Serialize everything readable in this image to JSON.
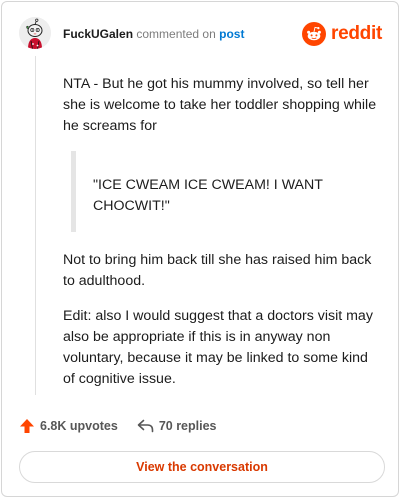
{
  "comment": {
    "username": "FuckUGalen",
    "action_text": "commented on",
    "post_link_label": "post",
    "paragraph_1": "NTA - But he got his mummy involved, so tell her she is welcome to take her toddler shopping while he screams for",
    "quote": "\"ICE CWEAM ICE CWEAM! I WANT CHOCWIT!\"",
    "paragraph_2": "Not to bring him back till she has raised him back to adulthood.",
    "paragraph_3": "Edit: also I would suggest that a doctors visit may also be appropriate if this is in anyway non voluntary, because it may be linked to some kind of cognitive issue."
  },
  "brand": {
    "logo_text": "reddit",
    "logo_icon": "reddit-snoo-icon",
    "color": "#ff4500"
  },
  "footer": {
    "upvotes_label": "6.8K upvotes",
    "upvote_icon": "upvote-arrow-icon",
    "replies_label": "70 replies",
    "reply_icon": "reply-arrow-icon"
  },
  "actions": {
    "view_conversation_label": "View the conversation"
  },
  "colors": {
    "accent": "#ff4500",
    "link": "#0079d3",
    "button_text": "#d93900",
    "muted_text": "#7c7c7c"
  }
}
